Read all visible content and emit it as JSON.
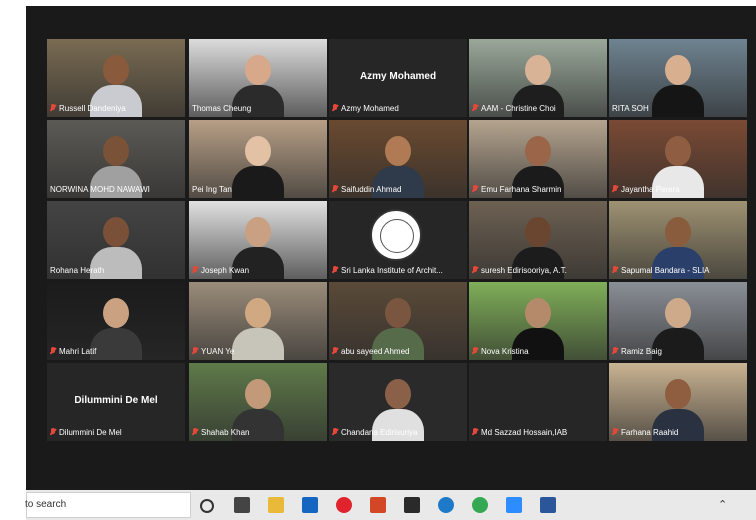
{
  "participants": [
    {
      "name": "Russell Dandeniya",
      "bg": "#7a6b52",
      "skin": "#8a5a3c",
      "shirt": "#c9cbd0",
      "muted": true
    },
    {
      "name": "Thomas Cheung",
      "bg": "#dcdcdc",
      "skin": "#d8a88a",
      "shirt": "#2b2b2b",
      "muted": false
    },
    {
      "name": "Azmy Mohamed",
      "display": "Azmy Mohamed",
      "muted": true
    },
    {
      "name": "AAM - Christine Choi",
      "bg": "#9aa89a",
      "skin": "#d9b396",
      "shirt": "#1e1e1e",
      "muted": true
    },
    {
      "name": "RITA SOH",
      "bg": "#6e8390",
      "skin": "#d8b090",
      "shirt": "#151515",
      "muted": false
    },
    {
      "name": "NORWINA MOHD NAWAWI",
      "bg": "#5c5a55",
      "skin": "#7a5238",
      "shirt": "#a0a0a0",
      "muted": false
    },
    {
      "name": "Pei Ing Tan",
      "bg": "#b79f86",
      "skin": "#e2c1a5",
      "shirt": "#1a1a1a",
      "muted": false
    },
    {
      "name": "Saifuddin Ahmad",
      "bg": "#6a4a30",
      "skin": "#b07a55",
      "shirt": "#2f3a4a",
      "muted": true
    },
    {
      "name": "Emu Farhana Sharmin",
      "bg": "#b4a48e",
      "skin": "#9a6548",
      "shirt": "#1b1b1b",
      "muted": true
    },
    {
      "name": "Jayantha Perera",
      "bg": "#7a4a34",
      "skin": "#8f5e42",
      "shirt": "#e8e8e8",
      "muted": true
    },
    {
      "name": "Rohana Herath",
      "bg": "#444444",
      "skin": "#7a5038",
      "shirt": "#bcbcbc",
      "muted": false
    },
    {
      "name": "Joseph Kwan",
      "bg": "#e1e1e1",
      "skin": "#caa082",
      "shirt": "#222222",
      "muted": true
    },
    {
      "name": "Sri Lanka Institute of Archit...",
      "logo": true,
      "muted": true
    },
    {
      "name": "suresh Edirisooriya, A.T.",
      "bg": "#6d6152",
      "skin": "#6a4630",
      "shirt": "#1c1c1c",
      "muted": true
    },
    {
      "name": "Sapumal Bandara - SLIA",
      "bg": "#9e9272",
      "skin": "#8a5c3e",
      "shirt": "#2b3f6b",
      "muted": true
    },
    {
      "name": "Mahri Latif",
      "bg": "#1b1b1b",
      "skin": "#caa282",
      "shirt": "#3a3a3a",
      "muted": true
    },
    {
      "name": "YUAN Ye",
      "bg": "#9a8c7a",
      "skin": "#d0a882",
      "shirt": "#c7c4ba",
      "muted": true
    },
    {
      "name": "abu sayeed Ahmed",
      "bg": "#5a4a38",
      "skin": "#7a5640",
      "shirt": "#556b4a",
      "muted": true
    },
    {
      "name": "Nova Kristina",
      "bg": "#7fae58",
      "skin": "#b58a6a",
      "shirt": "#111111",
      "muted": true
    },
    {
      "name": "Ramiz Baig",
      "bg": "#8a8f96",
      "skin": "#cfaa8a",
      "shirt": "#1b1b1b",
      "muted": true
    },
    {
      "name": "Dilummini De Mel",
      "display": "Dilummini De Mel",
      "muted": true
    },
    {
      "name": "Shahab Khan",
      "bg": "#5f7a4a",
      "skin": "#c29a7a",
      "shirt": "#333333",
      "muted": true
    },
    {
      "name": "Chandana Edirisuriya",
      "bg": "#2a2a2a",
      "skin": "#8b6048",
      "shirt": "#e0e0e0",
      "muted": true
    },
    {
      "name": "Md Sazzad Hossain,IAB",
      "muted": true
    },
    {
      "name": "Farhana Raahid",
      "bg": "#c9b392",
      "skin": "#8f5d40",
      "shirt": "#2a3140",
      "muted": true
    }
  ],
  "taskbar": {
    "search_text": "to search",
    "apps": [
      {
        "icon": "task-view-icon",
        "color": "#333333"
      },
      {
        "icon": "multitasking-icon",
        "color": "#444444"
      },
      {
        "icon": "file-explorer-icon",
        "color": "#e9b93a"
      },
      {
        "icon": "outlook-icon",
        "color": "#1466c0"
      },
      {
        "icon": "opera-icon",
        "color": "#e0232d"
      },
      {
        "icon": "powerpoint-icon",
        "color": "#d24726"
      },
      {
        "icon": "mail-icon",
        "color": "#2a2a2a"
      },
      {
        "icon": "edge-icon",
        "color": "#1e79c8"
      },
      {
        "icon": "chrome-icon",
        "color": "#34a853"
      },
      {
        "icon": "zoom-icon",
        "color": "#2d8cff"
      },
      {
        "icon": "word-icon",
        "color": "#2b579a"
      }
    ]
  }
}
